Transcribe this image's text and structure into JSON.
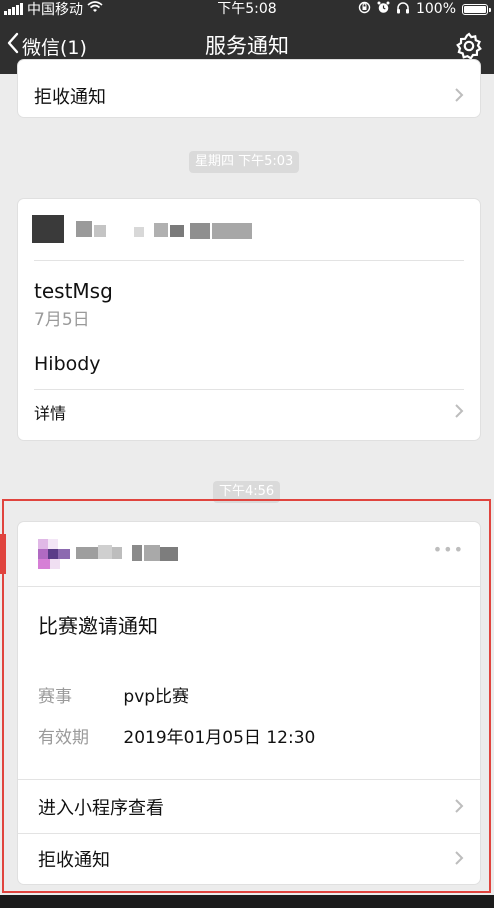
{
  "status_bar": {
    "carrier": "中国移动",
    "time": "下午5:08",
    "battery": "100%"
  },
  "nav": {
    "back_label": "微信(1)",
    "title": "服务通知"
  },
  "top_card": {
    "reject_label": "拒收通知"
  },
  "timestamps": {
    "first": "星期四 下午5:03",
    "second": "下午4:56"
  },
  "card1": {
    "title": "testMsg",
    "date": "7月5日",
    "body": "Hibody",
    "detail_label": "详情"
  },
  "card2": {
    "more": "•••",
    "title": "比赛邀请通知",
    "fields": [
      {
        "label": "赛事",
        "value": "pvp比赛"
      },
      {
        "label": "有效期",
        "value": "2019年01月05日 12:30"
      }
    ],
    "open_label": "进入小程序查看",
    "reject_label": "拒收通知"
  }
}
